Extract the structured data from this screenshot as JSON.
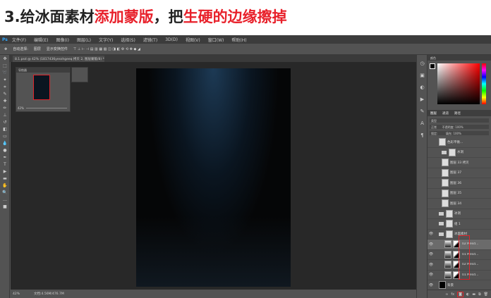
{
  "heading": {
    "prefix": "3.给冰面素材",
    "red1": "添加蒙版",
    "mid": "，把",
    "red2": "生硬的边缘擦掉"
  },
  "menu": [
    "Ps",
    "文件(F)",
    "编辑(E)",
    "图像(I)",
    "图层(L)",
    "文字(Y)",
    "选择(S)",
    "滤镜(T)",
    "3D(D)",
    "视图(V)",
    "窗口(W)",
    "帮助(H)"
  ],
  "options": {
    "auto_select": "自动选择:",
    "target": "图层",
    "transform": "显示变换控件"
  },
  "doc_tab": "8.1.psd @ 42% (1817436yesshgeeq 拷贝 2, 图层蒙版/8) *",
  "navigator": {
    "title": "导航器",
    "zoom": "42%"
  },
  "status": {
    "zoom": "42%",
    "doc": "文档:4.56M/476.7M"
  },
  "color_panel": {
    "title": "颜色"
  },
  "layers_panel": {
    "tabs": [
      "图层",
      "通道",
      "路径"
    ],
    "kind": "类型",
    "blend": "正常",
    "opacity_label": "不透明度:",
    "opacity": "100%",
    "lock_label": "锁定:",
    "fill_label": "填充:",
    "fill": "100%",
    "layers": [
      {
        "name": "色彩平衡...",
        "type": "adjust"
      },
      {
        "name": "水洞",
        "type": "group"
      },
      {
        "name": "图层 33 拷贝",
        "type": "layer"
      },
      {
        "name": "图层 37",
        "type": "layer"
      },
      {
        "name": "图层 36",
        "type": "layer"
      },
      {
        "name": "图层 35",
        "type": "layer"
      },
      {
        "name": "图层 34",
        "type": "layer"
      },
      {
        "name": "冰洞",
        "type": "group"
      },
      {
        "name": "组 1",
        "type": "group"
      },
      {
        "name": "冰面素材",
        "type": "group"
      },
      {
        "name": "02 Mésd...",
        "type": "masked",
        "selected": true
      },
      {
        "name": "01 Mésd...",
        "type": "masked"
      },
      {
        "name": "02 Mésd...",
        "type": "masked"
      },
      {
        "name": "01 Mésd...",
        "type": "masked"
      },
      {
        "name": "背景",
        "type": "bg"
      }
    ],
    "footer": [
      "fx",
      "add-mask",
      "adjust",
      "folder",
      "new",
      "trash"
    ]
  }
}
